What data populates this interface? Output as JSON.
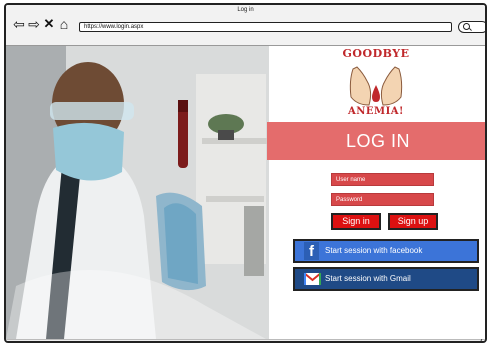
{
  "window": {
    "title": "Log in"
  },
  "browser": {
    "url": "https://www.login.aspx",
    "nav_icons": {
      "back": "arrow-left",
      "forward": "arrow-right",
      "stop": "x",
      "home": "home"
    }
  },
  "logo": {
    "line1": "GOODBYE",
    "line2": "ANEMIA!"
  },
  "login": {
    "heading": "LOG IN",
    "username_placeholder": "User name",
    "password_placeholder": "Password",
    "signin_label": "Sign in",
    "signup_label": "Sign up",
    "facebook_label": "Start session with facebook",
    "gmail_label": "Start session with Gmail"
  },
  "colors": {
    "banner": "#e46c6c",
    "field": "#d7484a",
    "button_red": "#dd1111",
    "facebook": "#3c74d8",
    "gmail": "#1f4a86"
  }
}
